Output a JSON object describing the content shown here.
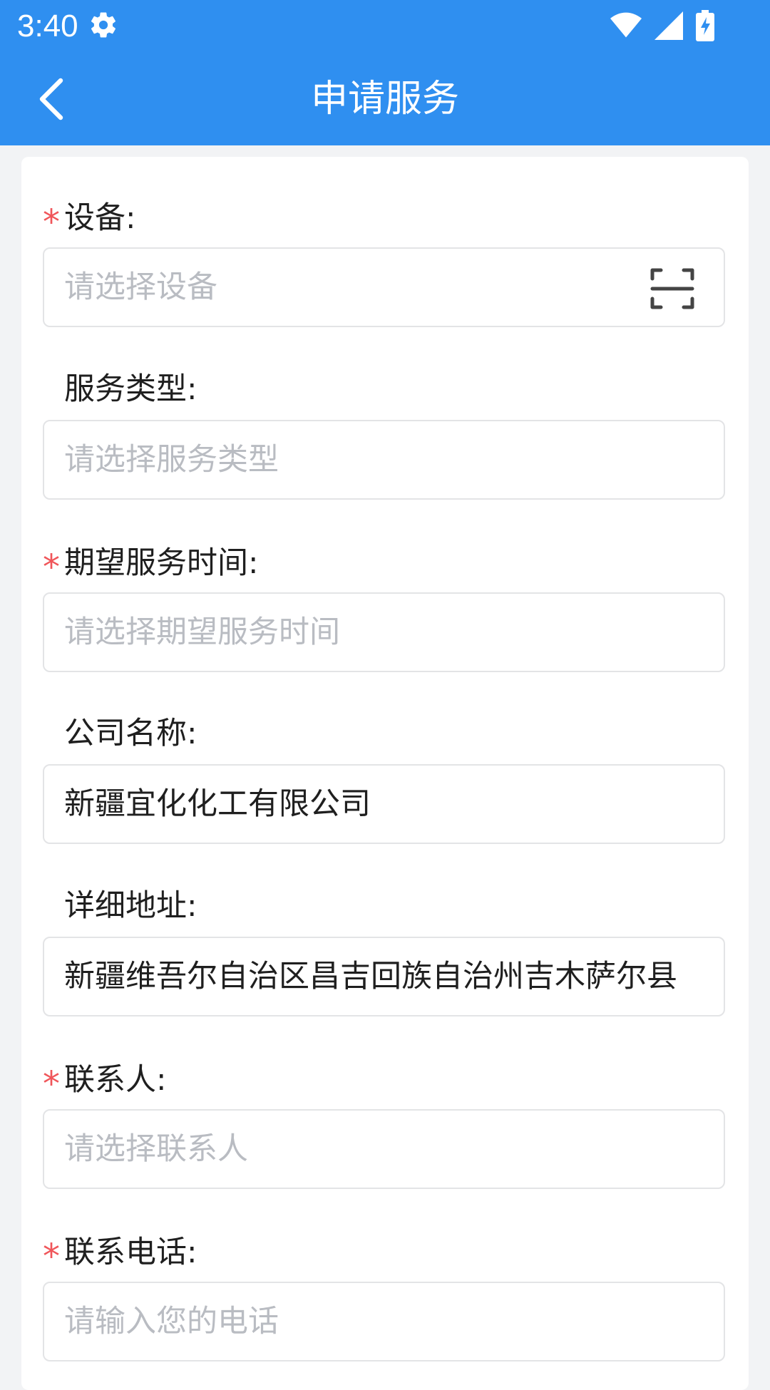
{
  "status_bar": {
    "time": "3:40",
    "icons": [
      "gear-icon",
      "wifi-icon",
      "signal-icon",
      "battery-charging-icon"
    ]
  },
  "app_bar": {
    "title": "申请服务",
    "back_icon": "chevron-left-icon"
  },
  "colors": {
    "brand": "#2f8ff0",
    "required_star": "#f0565a",
    "placeholder": "#b9bcc2",
    "text": "#1f1f1f",
    "background": "#f2f3f5"
  },
  "form": {
    "device": {
      "label": "设备:",
      "required": true,
      "placeholder": "请选择设备",
      "icon": "scan-icon"
    },
    "service_type": {
      "label": "服务类型:",
      "required": false,
      "placeholder": "请选择服务类型"
    },
    "expected_time": {
      "label": "期望服务时间:",
      "required": true,
      "placeholder": "请选择期望服务时间"
    },
    "company": {
      "label": "公司名称:",
      "required": false,
      "value": "新疆宜化化工有限公司"
    },
    "address": {
      "label": "详细地址:",
      "required": false,
      "value": "新疆维吾尔自治区昌吉回族自治州吉木萨尔县"
    },
    "contact": {
      "label": "联系人:",
      "required": true,
      "placeholder": "请选择联系人"
    },
    "phone": {
      "label": "联系电话:",
      "required": true,
      "placeholder": "请输入您的电话"
    }
  },
  "required_mark": "*"
}
